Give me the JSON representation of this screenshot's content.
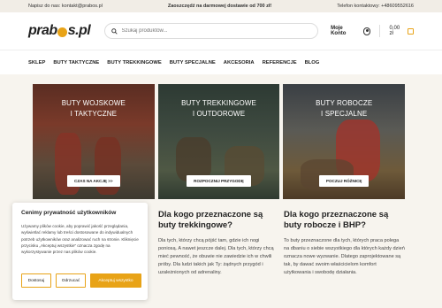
{
  "topbar": {
    "email": "Napisz do nas: kontakt@prabos.pl",
    "promo": "Zaoszczędź na darmowej dostawie od 700 zł!",
    "phone": "Telefon kontaktowy: +48609552616"
  },
  "header": {
    "logo_text": "prabos.pl",
    "search_placeholder": "Szukaj produktów...",
    "account_label": "Moje Konto",
    "cart_label": "0,00 zł"
  },
  "nav": [
    "SKLEP",
    "BUTY TAKTYCZNE",
    "BUTY TREKKINGOWE",
    "BUTY SPECJALNE",
    "AKCESORIA",
    "REFERENCJE",
    "BLOG"
  ],
  "tiles": [
    {
      "title_1": "BUTY WOJSKOWE",
      "title_2": "I TAKTYCZNE",
      "button": "CZAS NA AKCJĘ >>"
    },
    {
      "title_1": "BUTY TREKKINGOWE",
      "title_2": "I OUTDOROWE",
      "button": "ROZPOCZNIJ PRZYGODĘ"
    },
    {
      "title_1": "BUTY ROBOCZE",
      "title_2": "I SPECJALNE",
      "button": "POCZUJ RÓŻNICĘ"
    }
  ],
  "sections": {
    "trekking": {
      "heading": "Dla kogo przeznaczone są buty trekkingowe?",
      "text": "Dla tych, którzy chcą pójść tam, gdzie ich nogi poniosą. A nawet jeszcze dalej. Dla tych, którzy chcą mieć pewność, że obuwie nie zawiedzie ich w chwili próby. Dla ludzi takich jak Ty: żądnych przygód i uzależnionych od adrenaliny."
    },
    "work": {
      "heading": "Dla kogo przeznaczone są buty robocze i BHP?",
      "text": "To buty przeznaczone dla tych, których praca polega na dbaniu o siebie wszystkiego dla których każdy dzień oznacza nowe wyzwanie. Dlatego zaprojektowane są tak, by dawać swoim właścicielom komfort użytkowania i swobodę działania."
    }
  },
  "cookie": {
    "title": "Cenimy prywatność użytkowników",
    "text": "Używamy plików cookie, aby poprawić jakość przeglądania, wyświetlać reklamy lub treści dostosowane do indywidualnych potrzeb użytkowników oraz analizować ruch na stronie. Kliknięcie przycisku „Akceptuj wszystkie” oznacza zgodę na wykorzystywanie przez nas plików cookie.",
    "btn_customize": "Dostosuj",
    "btn_reject": "Odrzucać",
    "btn_accept": "Akceptuj wszystko"
  },
  "colors": {
    "accent": "#e8a317"
  }
}
